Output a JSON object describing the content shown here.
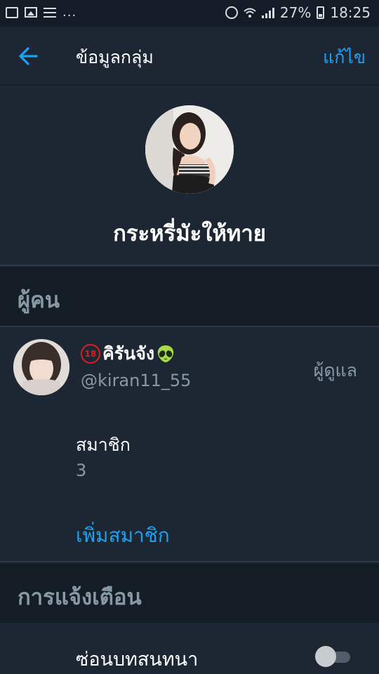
{
  "status_bar": {
    "dots": "...",
    "battery": "27%",
    "time": "18:25"
  },
  "app_bar": {
    "title": "ข้อมูลกลุ่ม",
    "edit_label": "แก้ไข",
    "back_icon": "arrow-left-icon"
  },
  "group": {
    "name": "กระหรี่มัะให้ทาย"
  },
  "people_section": {
    "header": "ผู้คน",
    "member": {
      "badge": "18",
      "name": "คิรันจัง",
      "handle": "@kiran11_55",
      "role": "ผู้ดูแล"
    },
    "member_count_label": "สมาชิก",
    "member_count": "3",
    "add_member_label": "เพิ่มสมาชิก"
  },
  "notifications_section": {
    "header": "การแจ้งเตือน",
    "hide_conversation_label": "ซ่อนบทสนทนา",
    "hide_conversation_on": false
  },
  "colors": {
    "accent": "#1da1f2",
    "background": "#1c2733",
    "section_background": "#141d26",
    "muted_text": "#8899a6"
  }
}
